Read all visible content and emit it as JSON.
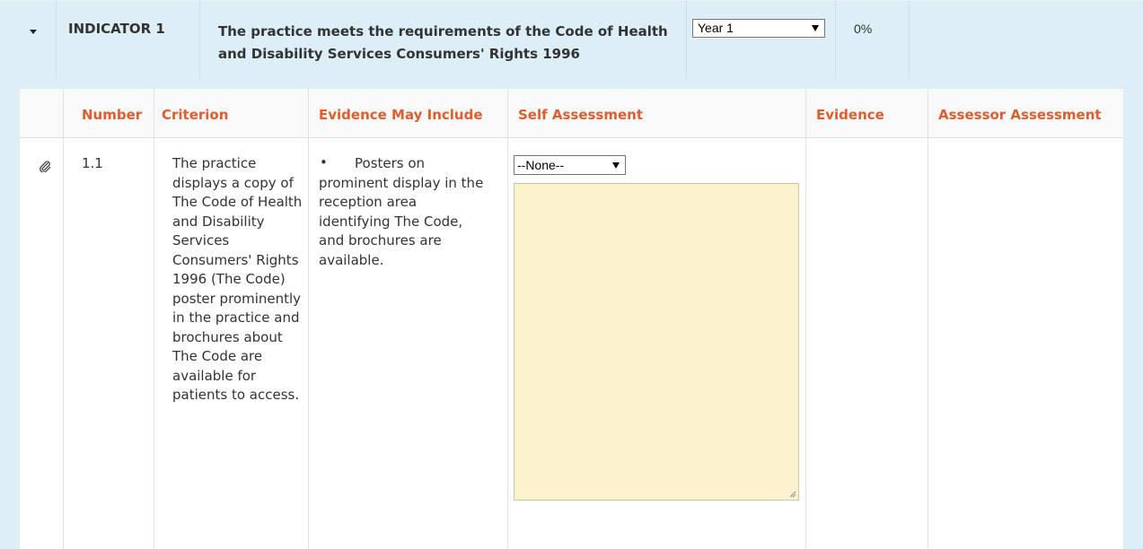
{
  "indicator": {
    "label": "INDICATOR 1",
    "text": "The practice meets the requirements of the Code of Health and Disability Services Consumers' Rights 1996",
    "year_select": "Year 1",
    "percent": "0%"
  },
  "table": {
    "headers": {
      "number": "Number",
      "criterion": "Criterion",
      "evidence_may_include": "Evidence May Include",
      "self_assessment": "Self Assessment",
      "evidence": "Evidence",
      "assessor_assessment": "Assessor Assessment"
    },
    "rows": [
      {
        "number": "1.1",
        "criterion": "The practice displays a copy of The Code of Health and Disability Services Consumers' Rights 1996 (The Code) poster prominently in the practice and brochures about The Code are available for patients to access.",
        "evidence_bullet": "•",
        "evidence_may_include": "Posters on prominent display in the reception area identifying The Code, and brochures are available.",
        "self_assessment_select": "--None--",
        "self_assessment_text": ""
      }
    ]
  },
  "colors": {
    "panel_bg": "#ddeef7",
    "header_text": "#e05d2e",
    "textarea_bg": "#fbf1cd"
  },
  "icons": {
    "toggle": "caret-down-icon",
    "attachment": "paperclip-icon"
  }
}
